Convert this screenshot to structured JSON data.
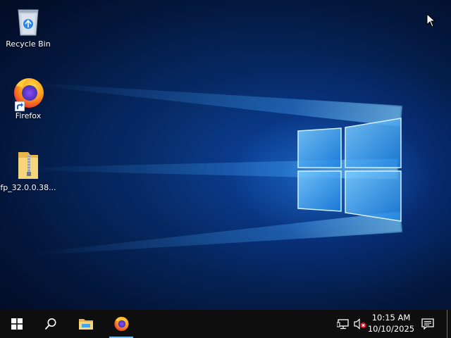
{
  "desktop": {
    "icons": [
      {
        "label": "Recycle Bin",
        "icon": "recycle-bin-icon"
      },
      {
        "label": "Firefox",
        "icon": "firefox-icon"
      },
      {
        "label": "fp_32.0.0.38...",
        "icon": "zip-folder-icon"
      }
    ]
  },
  "taskbar": {
    "start": "windows-start-icon",
    "search": "search-icon",
    "pinned": [
      "file-explorer-icon",
      "firefox-icon"
    ],
    "tray": {
      "network": "network-icon",
      "volume": "volume-muted-icon",
      "time": "10:15 AM",
      "date": "10/10/2025",
      "notifications": "action-center-icon"
    }
  },
  "colors": {
    "taskbar_bg": "#0f0f10",
    "active_indicator": "#76b9ed",
    "desktop_glow": "#288cff"
  }
}
